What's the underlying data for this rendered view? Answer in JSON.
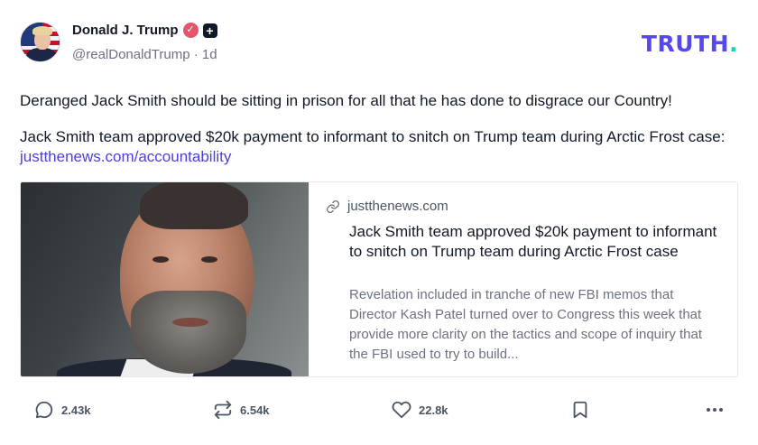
{
  "post": {
    "author": {
      "display_name": "Donald J. Trump",
      "handle": "@realDonaldTrump",
      "time": "· 1d",
      "verified_badge_color": "#e5546b"
    },
    "brand": {
      "logo_text": "TRUTH",
      "logo_dot": ".",
      "logo_color": "#5448ee",
      "dot_color": "#17d4b8"
    },
    "text_paragraph_1": "Deranged Jack Smith should be sitting in prison for all that he has done to disgrace our Country!",
    "text_paragraph_2": "Jack Smith team approved $20k payment to informant to snitch on Trump team during Arctic Frost case: ",
    "link_text": "justthenews.com/accountability",
    "link_color": "#4c3fe0",
    "card": {
      "domain": "justthenews.com",
      "title": "Jack Smith team approved $20k payment to informant to snitch on Trump team during Arctic Frost case",
      "description": "Revelation included in tranche of new FBI memos that Director Kash Patel turned over to Congress this week that provide more clarity on the tactics and scope of inquiry that the FBI used to try to build..."
    },
    "actions": {
      "replies": "2.43k",
      "retruths": "6.54k",
      "likes": "22.8k"
    }
  }
}
